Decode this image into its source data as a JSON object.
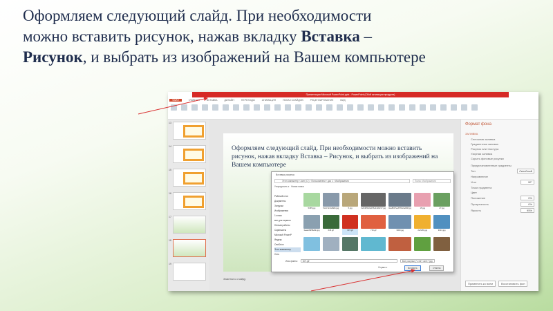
{
  "title": {
    "line1": "Оформляем следующий слайд. При необходимости",
    "line2_pre": "можно вставить рисунок, нажав вкладку ",
    "line2_bold": "Вставка",
    "line2_post": " –",
    "line3_bold": "Рисунок",
    "line3_post": ", и выбрать из изображений на Вашем компьютере"
  },
  "app": {
    "window_title": "Презентация Microsoft PowerPoint.pptx - PowerPoint (Сбой активации продукта)",
    "tabs": [
      "ФАЙЛ",
      "ГЛАВНАЯ",
      "ВСТАВКА",
      "ДИЗАЙН",
      "ПЕРЕХОДЫ",
      "АНИМАЦИЯ",
      "ПОКАЗ СЛАЙДОВ",
      "РЕЦЕНЗИРОВАНИЕ",
      "ВИД"
    ],
    "slide_numbers": [
      "13",
      "14",
      "15",
      "16",
      "17",
      "18",
      "19"
    ],
    "slide_text": "Оформляем следующий слайд. При необходимости можно вставить рисунок, нажав вкладку Вставка – Рисунок, и выбрать из изображений на Вашем компьютере",
    "notes": "Заметки к слайду",
    "panel": {
      "title": "Формат фона",
      "section": "ЗАЛИВКА",
      "options": [
        "Сплошная заливка",
        "Градиентная заливка",
        "Рисунок или текстура",
        "Узорная заливка",
        "Скрыть фоновые рисунки"
      ],
      "fields": [
        "Предустановленные градиенты",
        "Тип",
        "Направление",
        "Угол",
        "Точки градиента",
        "Цвет",
        "Положение",
        "Прозрачность",
        "Яркость"
      ],
      "type_value": "Линейный",
      "angle_value": "90°",
      "position_value": "0%",
      "transparency_value": "0%",
      "brightness_value": "95%",
      "apply_all": "Применить ко всем",
      "reset": "Восстановить фон"
    },
    "dialog": {
      "title": "Вставка рисунка",
      "path": "Этот компьютер › Acer (C:) › Пользователи › дис 1 › Изображения",
      "search": "Поиск: Изображения",
      "organize": "Упорядочить ▾",
      "new_folder": "Новая папка",
      "nav": [
        "Рабочий стол",
        "Документы",
        "Загрузки",
        "Изображения",
        "1 класс",
        "все для первого",
        "Нельзя работы",
        "Скриншоты",
        "Microsoft PowerP",
        "Яндекс",
        "OneDrive",
        "Этот компьютер",
        "Сеть"
      ],
      "files": [
        "5455.jpg",
        "5c2c7a7a48db.jpg",
        "5.jpg",
        "0e5465b2a378e34d6217.jpg",
        "0ea8037ee876b2ad84f.jpg",
        "15.jpg",
        "27.jpg",
        "3eaeb8958a5b.jpg",
        "645.gif",
        "607.gif",
        "715.gif",
        "3000.jpg",
        "2a725b.jpg",
        "9313.jpg",
        "",
        "",
        "",
        "",
        "",
        "",
        ""
      ],
      "colors": [
        "#a8d8a0",
        "#8899aa",
        "#b9a77a",
        "#666",
        "#6a7a8a",
        "#e8a0b0",
        "#6aa060",
        "#8aa0b0",
        "#3a6a3a",
        "#d03020",
        "#e06040",
        "#7090b0",
        "#f0b030",
        "#5090c0",
        "#80c0e0",
        "#a0b0c0",
        "#557766",
        "#60b8d0",
        "#c06040",
        "#60a040",
        "#806040"
      ],
      "selected_index": 9,
      "filename_label": "Имя файла:",
      "filename": "607.gif",
      "filter": "Все рисунки (*.emf;*.wmf;*.jpg;",
      "service": "Сервис ▾",
      "insert": "Вставить",
      "cancel": "Отмена"
    }
  },
  "colors": {
    "title_text": "#1f2d4d",
    "titlebar": "#d62a26",
    "arrow": "#d93030"
  }
}
